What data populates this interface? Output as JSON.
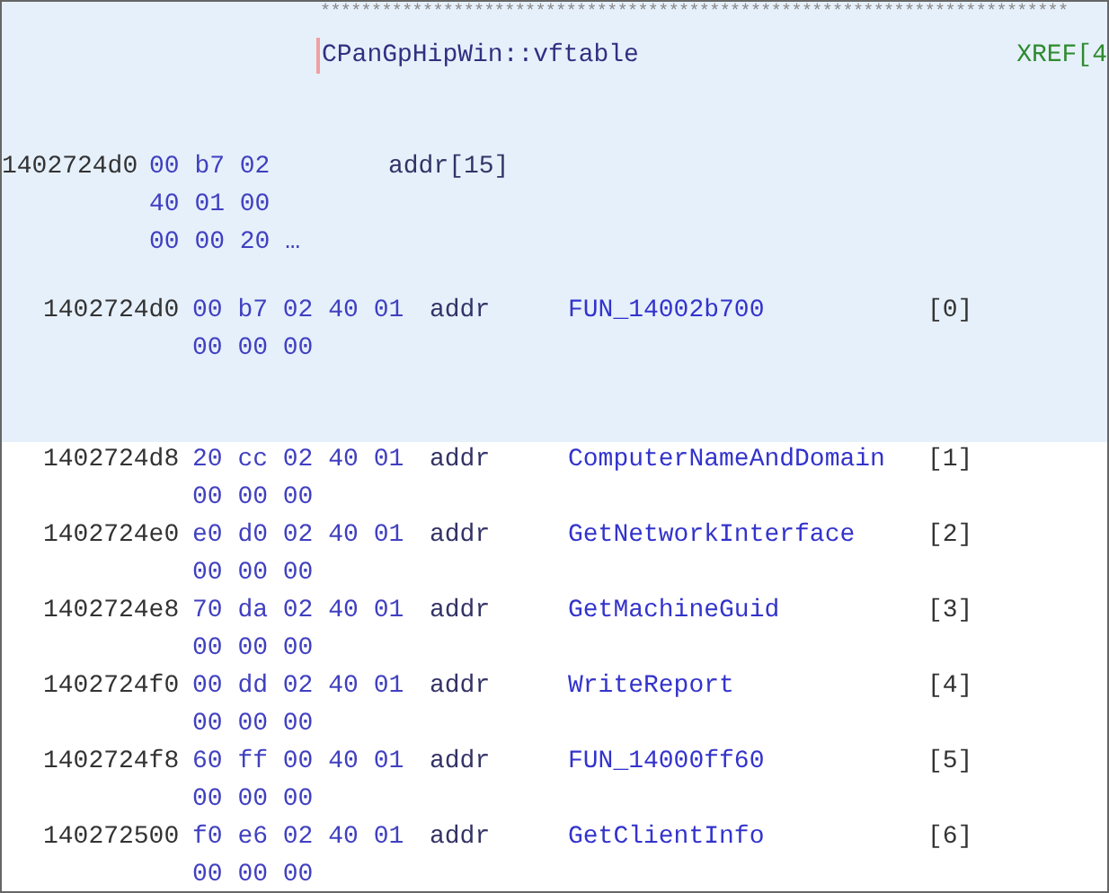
{
  "listing": {
    "comment_stars": "*************************************************************************",
    "label": "CPanGpHipWin::vftable",
    "xref": "XREF[4",
    "header": {
      "selected": true,
      "address": "1402724d0",
      "bytes": [
        "00 b7 02",
        "40 01 00",
        "00 00 20 …"
      ],
      "mnemonic": "addr[15]"
    },
    "elements": [
      {
        "selected": true,
        "address": "1402724d0",
        "bytes": [
          "00 b7 02 40 01",
          "00 00 00"
        ],
        "mnemonic": "addr",
        "operand": "FUN_14002b700",
        "index": "[0]"
      },
      {
        "selected": false,
        "address": "1402724d8",
        "bytes": [
          "20 cc 02 40 01",
          "00 00 00"
        ],
        "mnemonic": "addr",
        "operand": "ComputerNameAndDomain",
        "index": "[1]"
      },
      {
        "selected": false,
        "address": "1402724e0",
        "bytes": [
          "e0 d0 02 40 01",
          "00 00 00"
        ],
        "mnemonic": "addr",
        "operand": "GetNetworkInterface",
        "index": "[2]"
      },
      {
        "selected": false,
        "address": "1402724e8",
        "bytes": [
          "70 da 02 40 01",
          "00 00 00"
        ],
        "mnemonic": "addr",
        "operand": "GetMachineGuid",
        "index": "[3]"
      },
      {
        "selected": false,
        "address": "1402724f0",
        "bytes": [
          "00 dd 02 40 01",
          "00 00 00"
        ],
        "mnemonic": "addr",
        "operand": "WriteReport",
        "index": "[4]"
      },
      {
        "selected": false,
        "address": "1402724f8",
        "bytes": [
          "60 ff 00 40 01",
          "00 00 00"
        ],
        "mnemonic": "addr",
        "operand": "FUN_14000ff60",
        "index": "[5]"
      },
      {
        "selected": false,
        "address": "140272500",
        "bytes": [
          "f0 e6 02 40 01",
          "00 00 00"
        ],
        "mnemonic": "addr",
        "operand": "GetClientInfo",
        "index": "[6]"
      }
    ]
  }
}
